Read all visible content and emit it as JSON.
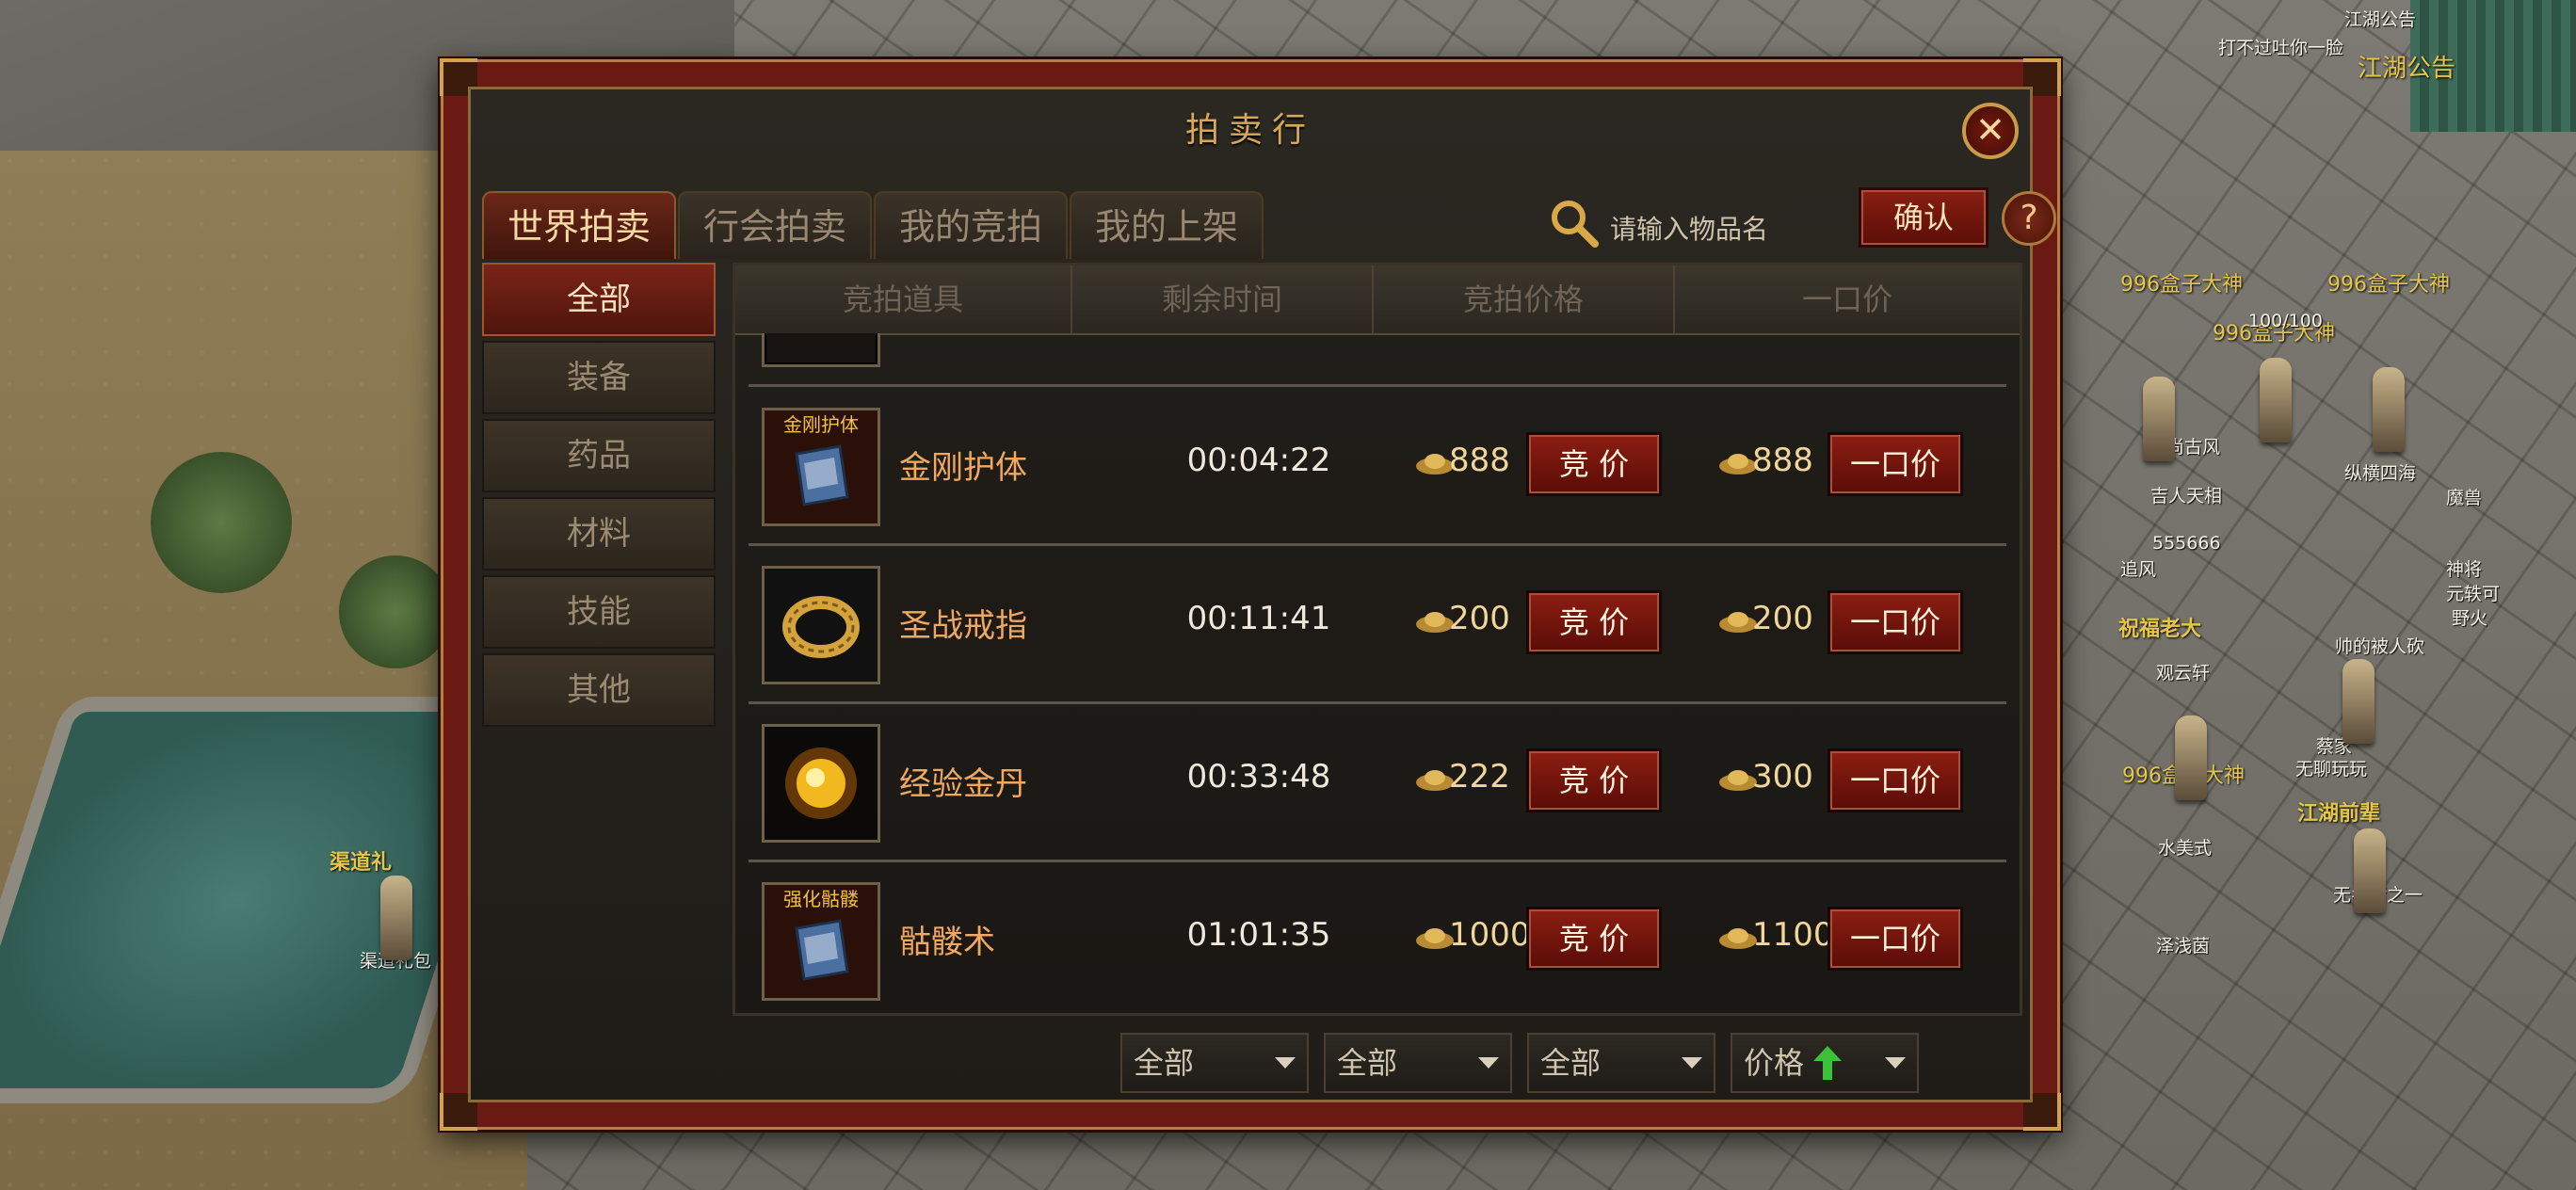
{
  "window": {
    "title": "拍卖行",
    "close_icon": "close-icon",
    "tabs": [
      {
        "label": "世界拍卖",
        "active": true
      },
      {
        "label": "行会拍卖",
        "active": false
      },
      {
        "label": "我的竞拍",
        "active": false
      },
      {
        "label": "我的上架",
        "active": false
      }
    ],
    "search": {
      "placeholder": "请输入物品名",
      "confirm_label": "确认",
      "help_label": "?"
    },
    "categories": [
      {
        "label": "全部",
        "active": true
      },
      {
        "label": "装备",
        "active": false
      },
      {
        "label": "药品",
        "active": false
      },
      {
        "label": "材料",
        "active": false
      },
      {
        "label": "技能",
        "active": false
      },
      {
        "label": "其他",
        "active": false
      }
    ],
    "columns": [
      "竞拍道具",
      "剩余时间",
      "竞拍价格",
      "一口价"
    ],
    "rows": [
      {
        "icon_label": "金刚护体",
        "icon": "skill-book-icon",
        "name": "金刚护体",
        "time": "00:04:22",
        "bid_price": "888",
        "bid_label": "竞 价",
        "buyout_price": "888",
        "buyout_label": "一口价"
      },
      {
        "icon_label": "",
        "icon": "gold-ring-icon",
        "name": "圣战戒指",
        "time": "00:11:41",
        "bid_price": "200",
        "bid_label": "竞 价",
        "buyout_price": "200",
        "buyout_label": "一口价"
      },
      {
        "icon_label": "",
        "icon": "golden-pill-icon",
        "name": "经验金丹",
        "time": "00:33:48",
        "bid_price": "222",
        "bid_label": "竞 价",
        "buyout_price": "300",
        "buyout_label": "一口价"
      },
      {
        "icon_label": "强化骷髅",
        "icon": "skill-book-icon",
        "name": "骷髅术",
        "time": "01:01:35",
        "bid_price": "1000",
        "bid_label": "竞 价",
        "buyout_price": "1100",
        "buyout_label": "一口价"
      }
    ],
    "filters": [
      {
        "value": "全部"
      },
      {
        "value": "全部"
      },
      {
        "value": "全部"
      },
      {
        "value": "价格",
        "icon": "arrow-up-icon"
      }
    ]
  },
  "scene": {
    "announce_title": "江湖公告",
    "announce_sign": "江湖公告",
    "npc_chat": "打不过吐你一脸",
    "npc_left": "渠道礼包",
    "npc_left_sign": "渠道礼",
    "player_titles": [
      "996盒子大神",
      "996盒子大神",
      "996盒子大神",
      "祝福老大",
      "996盒子大神",
      "江湖前辈"
    ],
    "player_names": [
      "时尚古风",
      "吉人天相",
      "追风",
      "555666",
      "纵横四海",
      "魔兽",
      "神将",
      "元轶可",
      "野火",
      "观云轩",
      "水美式",
      "泽浅茵",
      "蔡家",
      "无聊玩玩",
      "无名猪之一",
      "帅的被人砍",
      "100/100"
    ]
  }
}
